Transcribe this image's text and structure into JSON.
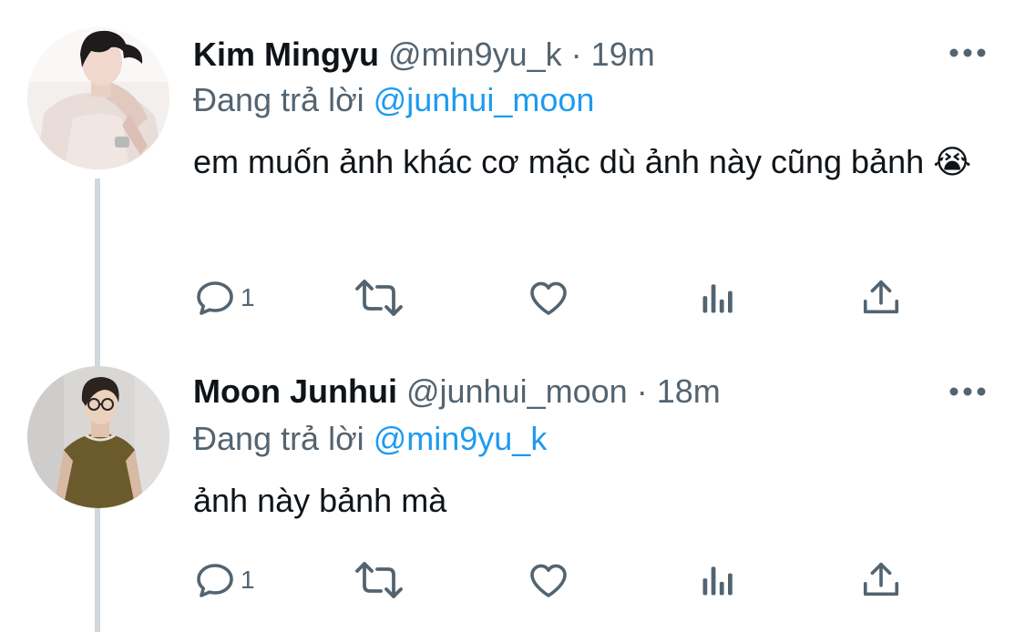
{
  "theme": {
    "text": "#0f1419",
    "secondary": "#536471",
    "accent": "#1d9bf0",
    "thread_line": "#cfd9de",
    "icon": "#536471"
  },
  "tweets": [
    {
      "display_name": "Kim Mingyu",
      "handle": "@min9yu_k",
      "separator": "·",
      "time": "19m",
      "reply_prefix": "Đang trả lời",
      "reply_mention": "@junhui_moon",
      "text": "em muốn ảnh khác cơ mặc dù ảnh này cũng bảnh 😭",
      "reply_count": "1",
      "icons": [
        "reply-icon",
        "retweet-icon",
        "like-icon",
        "analytics-icon",
        "share-icon",
        "more-icon"
      ]
    },
    {
      "display_name": "Moon Junhui",
      "handle": "@junhui_moon",
      "separator": "·",
      "time": "18m",
      "reply_prefix": "Đang trả lời",
      "reply_mention": "@min9yu_k",
      "text": "ảnh này bảnh mà",
      "reply_count": "1",
      "icons": [
        "reply-icon",
        "retweet-icon",
        "like-icon",
        "analytics-icon",
        "share-icon",
        "more-icon"
      ]
    }
  ]
}
